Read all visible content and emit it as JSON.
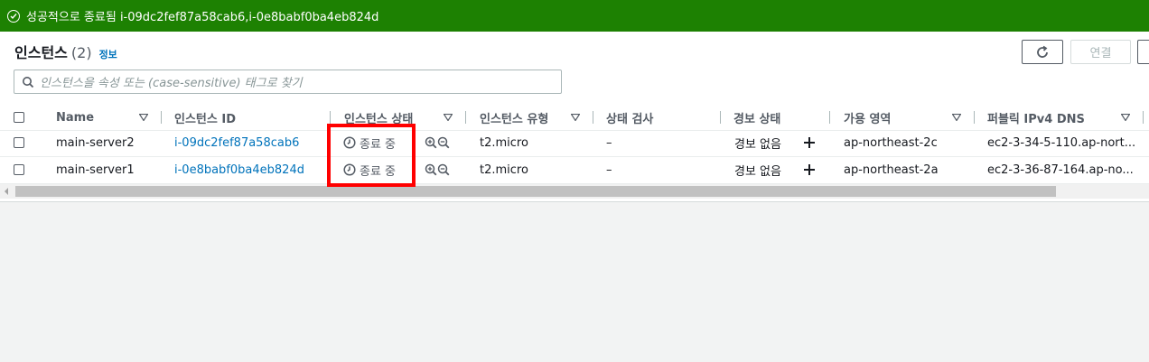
{
  "flash": {
    "message": "성공적으로 종료됨 i-09dc2fef87a58cab6,i-0e8babf0ba4eb824d"
  },
  "header": {
    "title": "인스턴스",
    "count": "(2)",
    "info": "정보",
    "connect_label": "연결"
  },
  "search": {
    "placeholder": "인스턴스을 속성 또는 (case-sensitive) 태그로 찾기"
  },
  "columns": {
    "name": "Name",
    "instance_id": "인스턴스 ID",
    "instance_state": "인스턴스 상태",
    "instance_type": "인스턴스 유형",
    "status_check": "상태 검사",
    "alarm_status": "경보 상태",
    "availability_zone": "가용 영역",
    "public_dns": "퍼블릭 IPv4 DNS"
  },
  "rows": [
    {
      "name": "main-server2",
      "instance_id": "i-09dc2fef87a58cab6",
      "state": "종료 중",
      "type": "t2.micro",
      "status_check": "–",
      "alarm": "경보 없음",
      "az": "ap-northeast-2c",
      "dns": "ec2-3-34-5-110.ap-nort..."
    },
    {
      "name": "main-server1",
      "instance_id": "i-0e8babf0ba4eb824d",
      "state": "종료 중",
      "type": "t2.micro",
      "status_check": "–",
      "alarm": "경보 없음",
      "az": "ap-northeast-2a",
      "dns": "ec2-3-36-87-164.ap-no..."
    }
  ],
  "colors": {
    "success": "#1d8102",
    "link": "#0073bb",
    "highlight": "#ff0000"
  }
}
